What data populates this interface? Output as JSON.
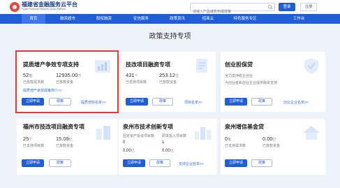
{
  "header": {
    "brand_cn": "福建省金融服务云平台",
    "brand_en": "Fujian Financial Services Cloud Platform",
    "search_placeholder": "请输入产品或机构或政策",
    "login": "登录",
    "register": "注册"
  },
  "nav": [
    "首页",
    "融资超市",
    "股权融资",
    "征信服务",
    "政策资讯",
    "招商云",
    "特色服务专区",
    "工作台"
  ],
  "section_title": "政策支持专项",
  "cards": [
    {
      "title": "提质增产争效专项支持",
      "stat1_value": "52",
      "stat1_unit": "笔",
      "stat1_label": "已放款需求数",
      "stat2_value": "12935.00",
      "stat2_unit": "万",
      "stat2_label": "已放款资金",
      "link": "提质增产争效政策简介>>",
      "btn_apply": "立即申请",
      "btn_policy": "政策",
      "more_link": "提质增效名单>>"
    },
    {
      "title": "技改项目融资专项",
      "stat1_value": "431",
      "stat1_unit": "个",
      "stat1_label": "已支持项目数",
      "stat2_value": "253.12",
      "stat2_unit": "亿",
      "stat2_label": "已放款资金",
      "btn_apply": "立即申请",
      "btn_policy": "政策",
      "more_link": "项目名单>>"
    },
    {
      "title": "创业担保贷",
      "desc1": "全力支持稳企创业",
      "desc2": "为创业者和创业企业提供融资支持",
      "btn_apply": "立即申请",
      "btn_policy": "政策",
      "more_link": "创业企业名单>>"
    },
    {
      "title": "福州市技改项目融资专项",
      "stat1_value": "25",
      "stat1_unit": "个",
      "stat1_label": "已支持项目数",
      "stat2_value": "15.09",
      "stat2_unit": "亿",
      "stat2_label": "已放款资金",
      "btn_apply": "立即申请",
      "btn_policy": "政策"
    },
    {
      "title": "泉州市技术创新专项",
      "desc1": "固定资产投资项目数",
      "desc2": "研发投入项目数",
      "r1a": "0",
      "r1b": "1",
      "r2a_value": "0.00",
      "r2a_unit": "亿",
      "r2b_value": "0.00",
      "r2b_unit": "亿",
      "btn_apply": "立即申请",
      "btn_policy": "政策",
      "more_link": "支持企业名单>>"
    },
    {
      "title": "泉州增信基金贷",
      "stat1_value": "0",
      "stat1_unit": "笔",
      "stat1_label": "已支持需求数",
      "stat2_value": "0.00",
      "stat2_unit": "亿",
      "stat2_label": "已放款资金",
      "btn_apply": "立即申请",
      "btn_policy": "政策"
    }
  ],
  "colors": {
    "primary": "#1f5fd6",
    "highlight_border": "#e03a3a"
  }
}
